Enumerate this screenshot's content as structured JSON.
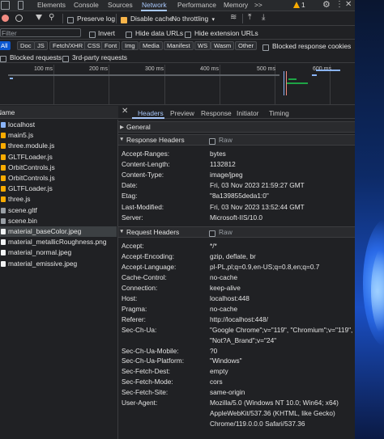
{
  "top_tabs": [
    "Elements",
    "Console",
    "Sources",
    "Network",
    "Performance",
    "Memory"
  ],
  "more_tabs": ">>",
  "warning_count": "1",
  "toolbar": {
    "preserve_log": "Preserve log",
    "disable_cache": "Disable cache",
    "throttling": "No throttling"
  },
  "filter": {
    "placeholder": "Filter",
    "invert": "Invert",
    "hide_data_urls": "Hide data URLs",
    "hide_extension_urls": "Hide extension URLs"
  },
  "type_filters": [
    "All",
    "Doc",
    "JS",
    "Fetch/XHR",
    "CSS",
    "Font",
    "Img",
    "Media",
    "Manifest",
    "WS",
    "Wasm",
    "Other"
  ],
  "blocked_response_cookies": "Blocked response cookies",
  "blocked_requests": "Blocked requests",
  "third_party_requests": "3rd-party requests",
  "timeline_ticks": [
    "100 ms",
    "200 ms",
    "300 ms",
    "400 ms",
    "500 ms",
    "600 ms"
  ],
  "name_column": "Name",
  "files": [
    {
      "name": "localhost",
      "kind": "doc"
    },
    {
      "name": "main5.js",
      "kind": "js"
    },
    {
      "name": "three.module.js",
      "kind": "js"
    },
    {
      "name": "GLTFLoader.js",
      "kind": "js"
    },
    {
      "name": "OrbitControls.js",
      "kind": "js"
    },
    {
      "name": "OrbitControls.js",
      "kind": "js"
    },
    {
      "name": "GLTFLoader.js",
      "kind": "js"
    },
    {
      "name": "three.js",
      "kind": "js"
    },
    {
      "name": "scene.gltf",
      "kind": "other"
    },
    {
      "name": "scene.bin",
      "kind": "other"
    },
    {
      "name": "material_baseColor.jpeg",
      "kind": "img"
    },
    {
      "name": "material_metallicRoughness.png",
      "kind": "img"
    },
    {
      "name": "material_normal.jpeg",
      "kind": "img"
    },
    {
      "name": "material_emissive.jpeg",
      "kind": "img"
    }
  ],
  "selected_file_index": 10,
  "detail_tabs": [
    "Headers",
    "Preview",
    "Response",
    "Initiator",
    "Timing"
  ],
  "general_label": "General",
  "response_headers_label": "Response Headers",
  "request_headers_label": "Request Headers",
  "raw_label": "Raw",
  "response_headers": [
    {
      "k": "Accept-Ranges:",
      "v": "bytes"
    },
    {
      "k": "Content-Length:",
      "v": "1132812"
    },
    {
      "k": "Content-Type:",
      "v": "image/jpeg"
    },
    {
      "k": "Date:",
      "v": "Fri, 03 Nov 2023 21:59:27 GMT"
    },
    {
      "k": "Etag:",
      "v": "\"8a139855deda1:0\""
    },
    {
      "k": "Last-Modified:",
      "v": "Fri, 03 Nov 2023 13:52:44 GMT"
    },
    {
      "k": "Server:",
      "v": "Microsoft-IIS/10.0"
    }
  ],
  "request_headers": [
    {
      "k": "Accept:",
      "v": "*/*"
    },
    {
      "k": "Accept-Encoding:",
      "v": "gzip, deflate, br"
    },
    {
      "k": "Accept-Language:",
      "v": "pl-PL,pl;q=0.9,en-US;q=0.8,en;q=0.7"
    },
    {
      "k": "Cache-Control:",
      "v": "no-cache"
    },
    {
      "k": "Connection:",
      "v": "keep-alive"
    },
    {
      "k": "Host:",
      "v": "localhost:448"
    },
    {
      "k": "Pragma:",
      "v": "no-cache"
    },
    {
      "k": "Referer:",
      "v": "http://localhost:448/"
    },
    {
      "k": "Sec-Ch-Ua:",
      "v": "\"Google Chrome\";v=\"119\", \"Chromium\";v=\"119\","
    },
    {
      "k": "",
      "v": "\"Not?A_Brand\";v=\"24\""
    },
    {
      "k": "Sec-Ch-Ua-Mobile:",
      "v": "?0"
    },
    {
      "k": "Sec-Ch-Ua-Platform:",
      "v": "\"Windows\""
    },
    {
      "k": "Sec-Fetch-Dest:",
      "v": "empty"
    },
    {
      "k": "Sec-Fetch-Mode:",
      "v": "cors"
    },
    {
      "k": "Sec-Fetch-Site:",
      "v": "same-origin"
    },
    {
      "k": "User-Agent:",
      "v": "Mozilla/5.0 (Windows NT 10.0; Win64; x64)"
    },
    {
      "k": "",
      "v": "AppleWebKit/537.36 (KHTML, like Gecko)"
    },
    {
      "k": "",
      "v": "Chrome/119.0.0.0 Safari/537.36"
    }
  ],
  "colors": {
    "accent": "#a8c7fa",
    "selected_row": "#3c4043",
    "doc": "#8ab4f8",
    "js": "#f9ab00",
    "img": "#f1f3f4",
    "other": "#9aa0a6",
    "warning": "#f9ab00"
  }
}
